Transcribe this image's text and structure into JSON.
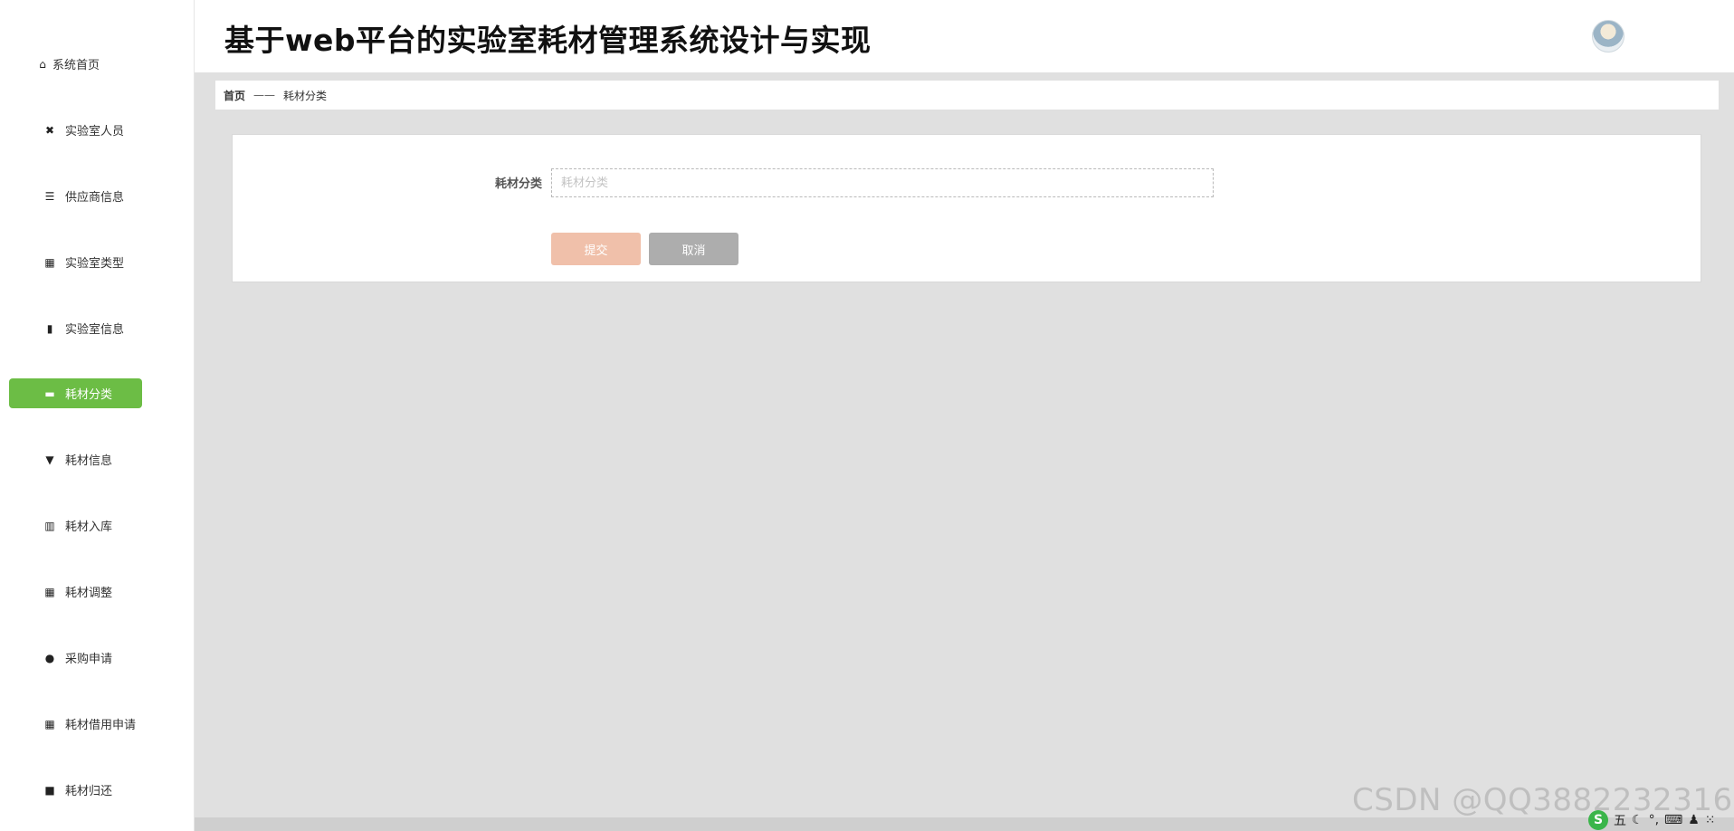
{
  "app": {
    "title": "基于web平台的实验室耗材管理系统设计与实现"
  },
  "sidebar": {
    "items": [
      {
        "label": "系统首页",
        "icon": "⌂",
        "icon_name": "home-icon",
        "active": false
      },
      {
        "label": "实验室人员",
        "icon": "✖",
        "icon_name": "users-icon",
        "active": false
      },
      {
        "label": "供应商信息",
        "icon": "☰",
        "icon_name": "sliders-icon",
        "active": false
      },
      {
        "label": "实验室类型",
        "icon": "▦",
        "icon_name": "grid-icon",
        "active": false
      },
      {
        "label": "实验室信息",
        "icon": "▮",
        "icon_name": "bar-chart-icon",
        "active": false
      },
      {
        "label": "耗材分类",
        "icon": "▬",
        "icon_name": "monitor-icon",
        "active": true
      },
      {
        "label": "耗材信息",
        "icon": "▼",
        "icon_name": "paint-roller-icon",
        "active": false
      },
      {
        "label": "耗材入库",
        "icon": "▥",
        "icon_name": "library-icon",
        "active": false
      },
      {
        "label": "耗材调整",
        "icon": "▦",
        "icon_name": "grid-icon",
        "active": false
      },
      {
        "label": "采购申请",
        "icon": "●",
        "icon_name": "user-icon",
        "active": false
      },
      {
        "label": "耗材借用申请",
        "icon": "▦",
        "icon_name": "grid-icon",
        "active": false
      },
      {
        "label": "耗材归还",
        "icon": "■",
        "icon_name": "briefcase-icon",
        "active": false
      }
    ]
  },
  "breadcrumb": {
    "home": "首页",
    "separator": "——",
    "current": "耗材分类"
  },
  "form": {
    "field_label": "耗材分类",
    "field_placeholder": "耗材分类",
    "field_value": "",
    "submit_label": "提交",
    "cancel_label": "取消"
  },
  "watermark": {
    "text": "CSDN @QQ3882232316"
  },
  "tray": {
    "ime_logo": "S",
    "ime_mode": "五",
    "moon": "☾",
    "dot": "°,",
    "keyboard": "⌨",
    "person": "♟",
    "apps": "⁙"
  },
  "colors": {
    "accent": "#6cbd45",
    "submit": "#f0c0aa",
    "cancel": "#adadad",
    "background": "#e0e0e0"
  }
}
